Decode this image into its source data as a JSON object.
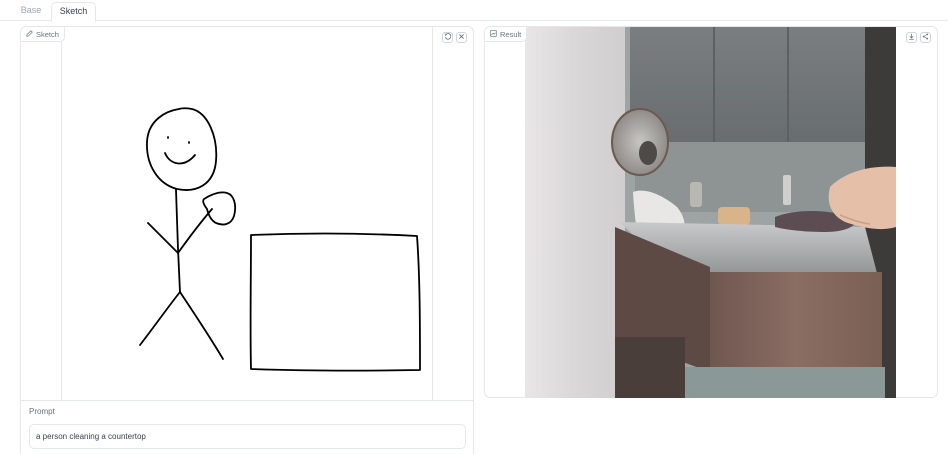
{
  "tabs": [
    {
      "label": "Base",
      "active": false
    },
    {
      "label": "Sketch",
      "active": true
    }
  ],
  "sketch_panel": {
    "label": "Sketch",
    "label_icon": "pencil-icon",
    "undo_icon": "undo-icon",
    "clear_icon": "close-icon"
  },
  "result_panel": {
    "label": "Result",
    "label_icon": "image-icon",
    "download_icon": "download-icon",
    "share_icon": "share-icon"
  },
  "prompt": {
    "label": "Prompt",
    "value": "a person cleaning a countertop"
  }
}
